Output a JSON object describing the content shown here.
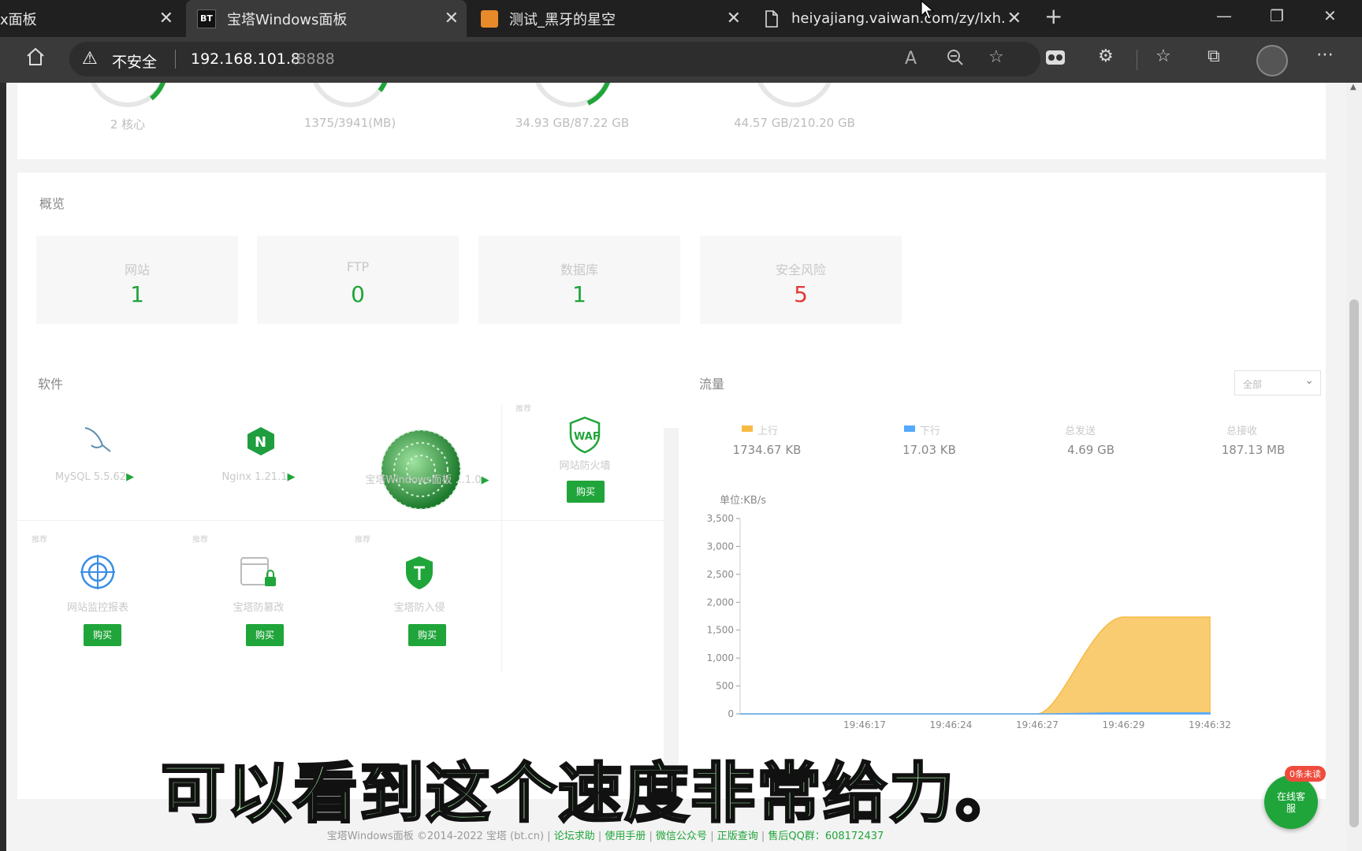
{
  "browser": {
    "tabs": [
      {
        "label": "x面板"
      },
      {
        "label": "宝塔Windows面板",
        "favicon_text": "BT"
      },
      {
        "label": "测试_黑牙的星空"
      },
      {
        "label": "heiyajiang.vaiwan.com/zy/lxh.mp"
      }
    ],
    "address": {
      "security": "不安全",
      "host": "192.168.101.8",
      "port": ":8888"
    }
  },
  "resources": [
    {
      "label": "2 核心"
    },
    {
      "label": "1375/3941(MB)"
    },
    {
      "label": "34.93 GB/87.22 GB"
    },
    {
      "label": "44.57 GB/210.20 GB"
    }
  ],
  "overview": {
    "title": "概览",
    "stats": [
      {
        "label": "网站",
        "value": "1"
      },
      {
        "label": "FTP",
        "value": "0"
      },
      {
        "label": "数据库",
        "value": "1"
      },
      {
        "label": "安全风险",
        "value": "5"
      }
    ]
  },
  "software": {
    "title": "软件",
    "recommend": "推荐",
    "buy": "购买",
    "items": [
      {
        "label": "MySQL 5.5.62"
      },
      {
        "label": "Nginx 1.21.1"
      },
      {
        "label": "宝塔Windows面板 ...1.0"
      },
      {
        "label": "网站防火墙",
        "icon": "WAF"
      },
      {
        "label": "网站监控报表"
      },
      {
        "label": "宝塔防篡改"
      },
      {
        "label": "宝塔防入侵"
      }
    ]
  },
  "traffic": {
    "title": "流量",
    "select": "全部",
    "legend": [
      {
        "label": "上行",
        "value": "1734.67 KB",
        "color": "#f7bb43"
      },
      {
        "label": "下行",
        "value": "17.03 KB",
        "color": "#52a9ff"
      },
      {
        "label": "总发送",
        "value": "4.69 GB"
      },
      {
        "label": "总接收",
        "value": "187.13 MB"
      }
    ],
    "unit": "单位:KB/s"
  },
  "chart_data": {
    "type": "area",
    "ylabel": "单位:KB/s",
    "ylim": [
      0,
      3500
    ],
    "yticks": [
      "3,500",
      "3,000",
      "2,500",
      "2,000",
      "1,500",
      "1,000",
      "500",
      "0"
    ],
    "x": [
      "19:46:17",
      "19:46:24",
      "19:46:27",
      "19:46:29",
      "19:46:32"
    ],
    "series": [
      {
        "name": "上行",
        "values": [
          0,
          0,
          0,
          1734.67,
          1734.67
        ]
      },
      {
        "name": "下行",
        "values": [
          0,
          0,
          0,
          17.03,
          17.03
        ]
      }
    ]
  },
  "subtitle": "可以看到这个速度非常给力。",
  "footer": {
    "copyright": "宝塔Windows面板 ©2014-2022 宝塔 (bt.cn)",
    "links": [
      "论坛求助",
      "使用手册",
      "微信公众号",
      "正版查询",
      "售后QQ群：608172437"
    ]
  },
  "chat": {
    "badge": "0条未读",
    "label": "在线客服"
  }
}
